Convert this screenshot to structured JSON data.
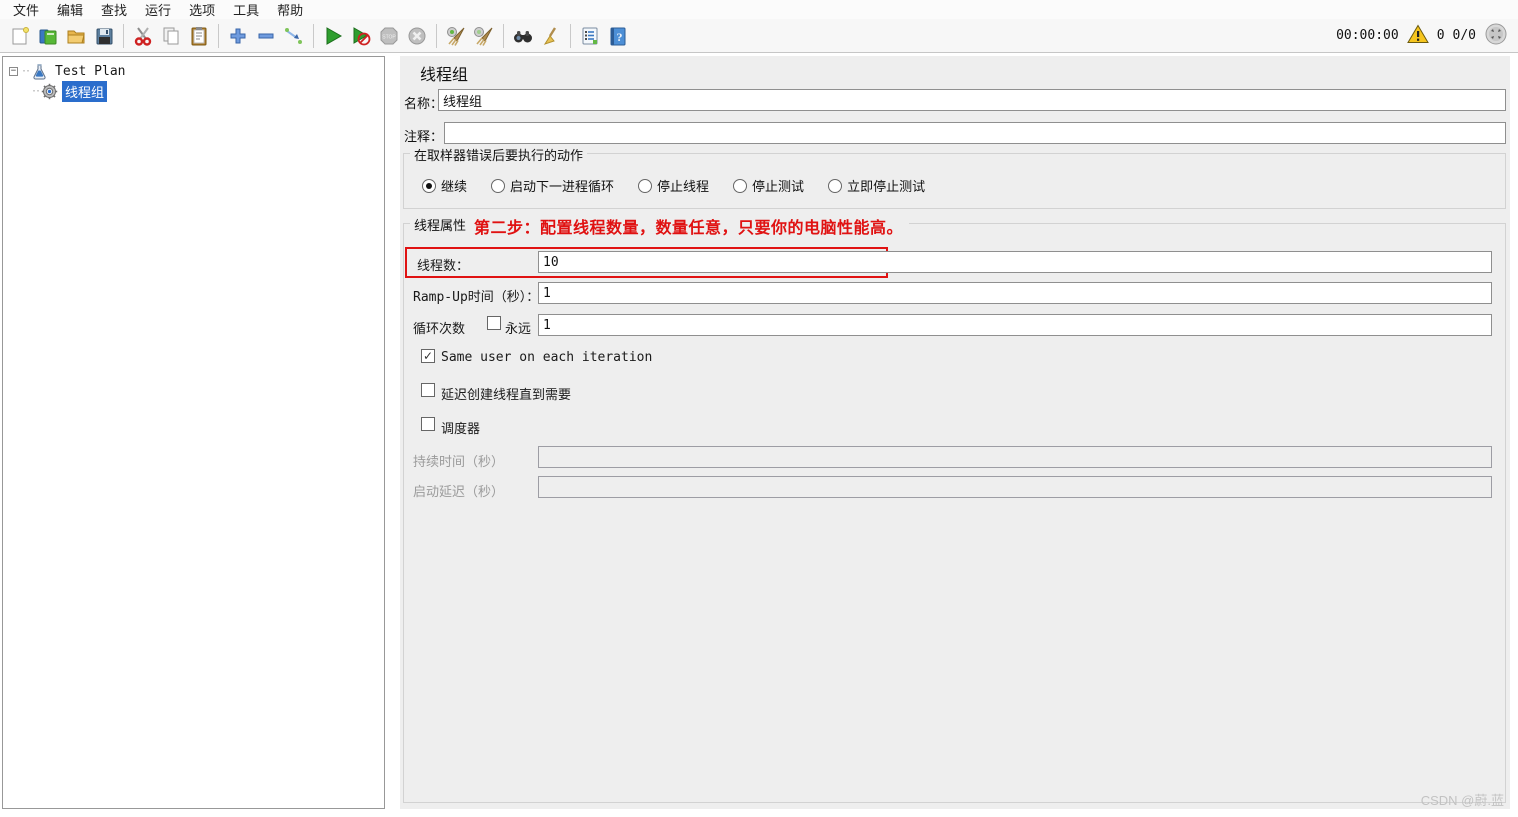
{
  "menu": {
    "items": [
      "文件",
      "编辑",
      "查找",
      "运行",
      "选项",
      "工具",
      "帮助"
    ]
  },
  "toolbar": {
    "icons": [
      "new-file",
      "templates",
      "open",
      "save",
      "cut",
      "copy",
      "paste",
      "add",
      "remove",
      "ramp-up",
      "start",
      "start-no-timers",
      "stop",
      "shutdown",
      "clear",
      "clear-all",
      "search",
      "clear-search",
      "function-helper",
      "help"
    ],
    "timer": "00:00:00",
    "error_count": "0",
    "thread_count": "0/0"
  },
  "tree": {
    "root_label": "Test Plan",
    "child_label": "线程组"
  },
  "main": {
    "title": "线程组",
    "name_label": "名称：",
    "name_value": "线程组",
    "comment_label": "注释：",
    "comment_value": "",
    "error_action": {
      "legend": "在取样器错误后要执行的动作",
      "options": [
        {
          "label": "继续",
          "selected": true
        },
        {
          "label": "启动下一进程循环",
          "selected": false
        },
        {
          "label": "停止线程",
          "selected": false
        },
        {
          "label": "停止测试",
          "selected": false
        },
        {
          "label": "立即停止测试",
          "selected": false
        }
      ]
    },
    "thread_props": {
      "legend": "线程属性",
      "annotation": "第二步：配置线程数量，数量任意，只要你的电脑性能高。",
      "threads_label": "线程数：",
      "threads_value": "10",
      "rampup_label": "Ramp-Up时间（秒）：",
      "rampup_value": "1",
      "loop_label": "循环次数",
      "forever_label": "永远",
      "forever_checked": false,
      "loop_value": "1",
      "same_user_label": "Same user on each iteration",
      "same_user_checked": true,
      "delay_create_label": "延迟创建线程直到需要",
      "delay_create_checked": false,
      "scheduler_label": "调度器",
      "scheduler_checked": false,
      "duration_label": "持续时间（秒）",
      "duration_value": "",
      "startup_delay_label": "启动延迟（秒）",
      "startup_delay_value": ""
    }
  },
  "watermark": "CSDN @蔚.蓝",
  "colors": {
    "selection_blue": "#2a6dcc",
    "annotation_red": "#e01212",
    "highlight_box_red": "#e01212",
    "panel_bg": "#eeeeee",
    "warning_yellow": "#f6c51e"
  }
}
